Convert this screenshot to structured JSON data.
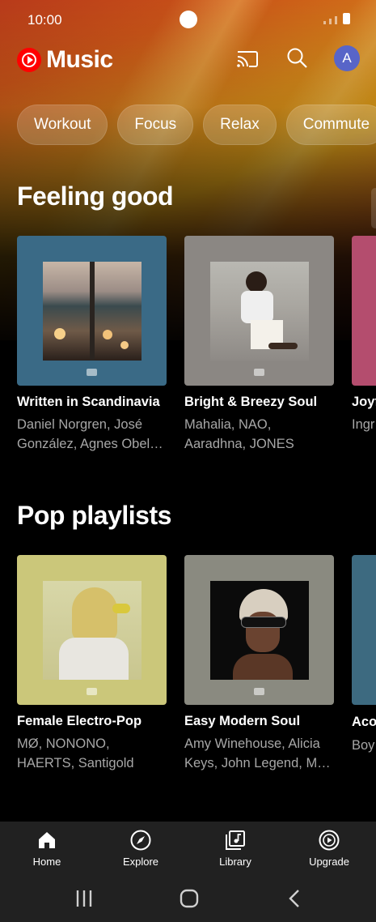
{
  "status_bar": {
    "time": "10:00"
  },
  "app": {
    "logo_text": "Music",
    "avatar_initial": "A"
  },
  "chips": [
    "Workout",
    "Focus",
    "Relax",
    "Commute"
  ],
  "sections": [
    {
      "title": "Feeling good",
      "cards": [
        {
          "title": "Written in Scandinavia",
          "subtitle": "Daniel Norgren, José González, Agnes Obel…"
        },
        {
          "title": "Bright & Breezy Soul",
          "subtitle": "Mahalia, NAO, Aaradhna, JONES"
        },
        {
          "title": "Joyf",
          "subtitle": "Ingr Kati"
        }
      ]
    },
    {
      "title": "Pop playlists",
      "cards": [
        {
          "title": "Female Electro-Pop",
          "subtitle": "MØ, NONONO, HAERTS, Santigold"
        },
        {
          "title": "Easy Modern Soul",
          "subtitle": "Amy Winehouse, Alicia Keys, John Legend, M…"
        },
        {
          "title": "Aco Love",
          "subtitle": "Boy Slee"
        }
      ]
    }
  ],
  "bottom_nav": [
    {
      "label": "Home",
      "icon": "home-icon",
      "active": true
    },
    {
      "label": "Explore",
      "icon": "compass-icon",
      "active": false
    },
    {
      "label": "Library",
      "icon": "library-icon",
      "active": false
    },
    {
      "label": "Upgrade",
      "icon": "upgrade-icon",
      "active": false
    }
  ],
  "colors": {
    "accent": "#ff0000",
    "avatar": "#5865c8",
    "nav_bg": "#212121"
  }
}
